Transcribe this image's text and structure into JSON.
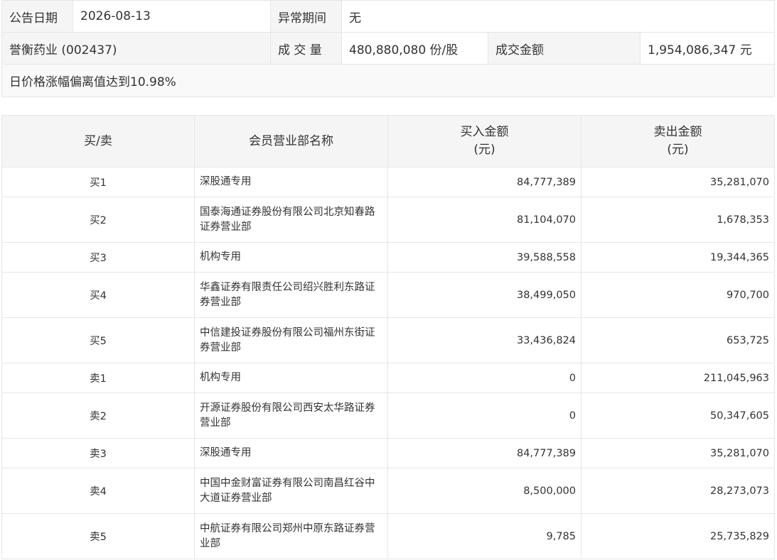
{
  "notice": {
    "date_label": "公告日期",
    "date_value": "2026-08-13",
    "abnormal_label": "异常期间",
    "abnormal_value": "无",
    "stock": "誉衡药业 (002437)",
    "volume_label": "成 交 量",
    "volume_value": "480,880,080 份/股",
    "amount_label": "成交金额",
    "amount_value": "1,954,086,347 元",
    "reason": "日价格涨幅偏离值达到10.98%"
  },
  "detail": {
    "headers": {
      "side": "买/卖",
      "dept": "会员营业部名称",
      "buy_line1": "买入金额",
      "buy_line2": "(元)",
      "sell_line1": "卖出金额",
      "sell_line2": "(元)"
    },
    "rows": [
      {
        "side": "买1",
        "dept": "深股通专用",
        "buy": "84,777,389",
        "sell": "35,281,070"
      },
      {
        "side": "买2",
        "dept": "国泰海通证券股份有限公司北京知春路证券营业部",
        "buy": "81,104,070",
        "sell": "1,678,353"
      },
      {
        "side": "买3",
        "dept": "机构专用",
        "buy": "39,588,558",
        "sell": "19,344,365"
      },
      {
        "side": "买4",
        "dept": "华鑫证券有限责任公司绍兴胜利东路证券营业部",
        "buy": "38,499,050",
        "sell": "970,700"
      },
      {
        "side": "买5",
        "dept": "中信建投证券股份有限公司福州东街证券营业部",
        "buy": "33,436,824",
        "sell": "653,725"
      },
      {
        "side": "卖1",
        "dept": "机构专用",
        "buy": "0",
        "sell": "211,045,963"
      },
      {
        "side": "卖2",
        "dept": "开源证券股份有限公司西安太华路证券营业部",
        "buy": "0",
        "sell": "50,347,605"
      },
      {
        "side": "卖3",
        "dept": "深股通专用",
        "buy": "84,777,389",
        "sell": "35,281,070"
      },
      {
        "side": "卖4",
        "dept": "中国中金财富证券有限公司南昌红谷中大道证券营业部",
        "buy": "8,500,000",
        "sell": "28,273,073"
      },
      {
        "side": "卖5",
        "dept": "中航证券有限公司郑州中原东路证券营业部",
        "buy": "9,785",
        "sell": "25,735,829"
      }
    ]
  }
}
